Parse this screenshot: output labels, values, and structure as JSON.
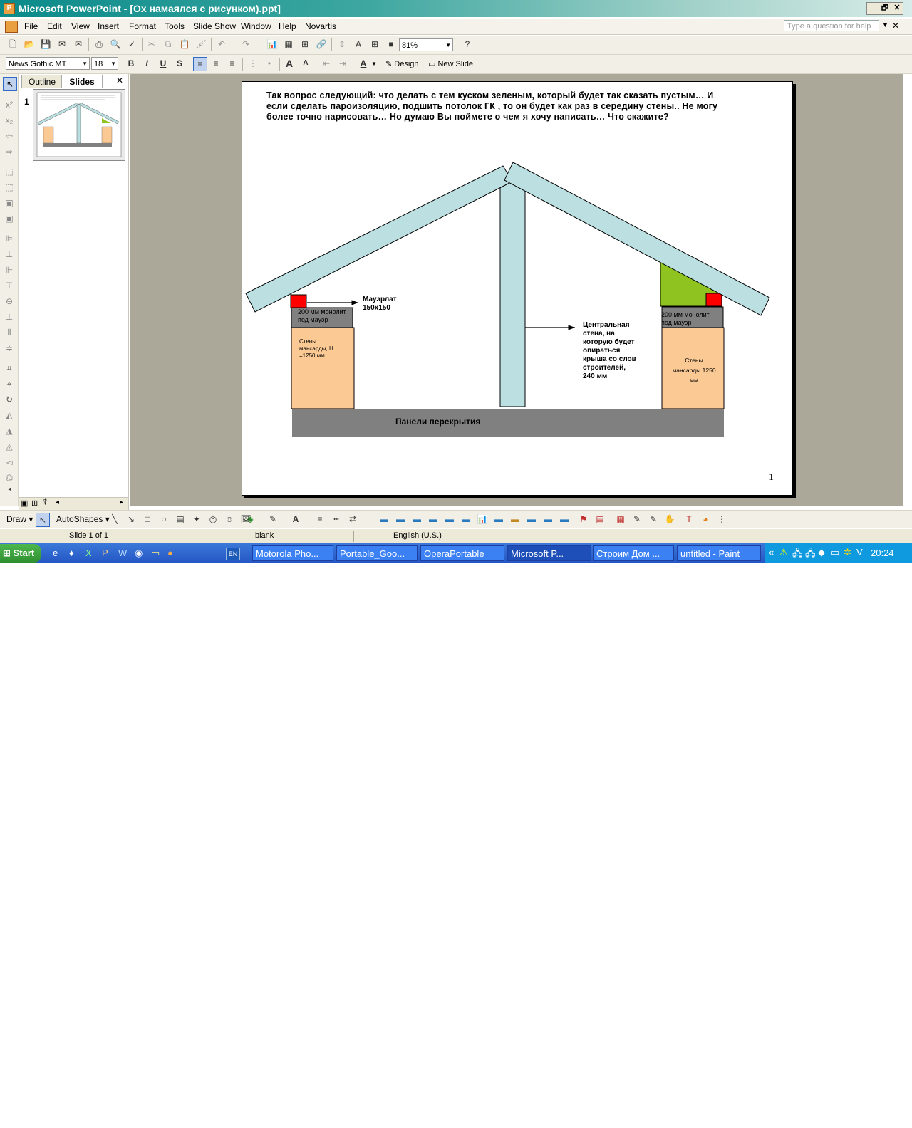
{
  "window": {
    "title": "Microsoft PowerPoint - [Ох намаялся с рисунком).ppt]",
    "minimize": "_",
    "restore": "🗗",
    "close": "✕"
  },
  "menu": {
    "items": [
      "File",
      "Edit",
      "View",
      "Insert",
      "Format",
      "Tools",
      "Slide Show",
      "Window",
      "Help",
      "Novartis"
    ],
    "help_placeholder": "Type a question for help",
    "close_doc": "✕"
  },
  "standard_toolbar": {
    "zoom": "81%"
  },
  "format_toolbar": {
    "font": "News Gothic MT",
    "size": "18",
    "bold": "B",
    "italic": "I",
    "underline": "U",
    "shadow": "S",
    "design": "Design",
    "new_slide": "New Slide"
  },
  "pane": {
    "tabs": [
      "Outline",
      "Slides"
    ],
    "close": "✕",
    "slide_number": "1"
  },
  "slide": {
    "text": "Так вопрос следующий: что делать с тем куском зеленым, который будет так сказать пустым…  И если сделать пароизоляцию, подшить потолок ГК , то он будет как раз в середину стены.. Не могу более точно нарисовать… Но думаю Вы поймете о чем я хочу написать… Что скажите?",
    "label_mauerlat": [
      "Мауэрлат",
      "150х150"
    ],
    "label_monolith_left": [
      "200 мм монолит",
      "под мауэр"
    ],
    "label_monolith_right": [
      "200 мм монолит",
      "под мауэр"
    ],
    "label_walls_left": [
      "Стены",
      "мансарды, Н",
      "=1250 мм"
    ],
    "label_walls_right": [
      "Стены",
      "мансарды 1250",
      "мм"
    ],
    "label_central": [
      "Центральная",
      "стена, на",
      "которую будет",
      "опираться",
      "крыша со слов",
      "строителей,",
      "240 мм"
    ],
    "label_slabs": "Панели перекрытия",
    "page_number": "1"
  },
  "draw_toolbar": {
    "draw": "Draw",
    "autoshapes": "AutoShapes"
  },
  "status": {
    "slide": "Slide 1 of 1",
    "design": "blank",
    "language": "English (U.S.)"
  },
  "taskbar": {
    "start": "Start",
    "lang": "EN",
    "tasks": [
      "Motorola Pho...",
      "Portable_Goo...",
      "OperaPortable",
      "Microsoft P...",
      "Строим Дом ...",
      "untitled - Paint"
    ],
    "clock": "20:24"
  }
}
